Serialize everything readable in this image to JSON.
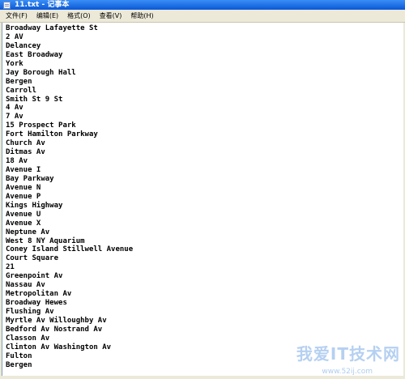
{
  "window": {
    "title": "11.txt - 记事本",
    "titlebar_color": "#0a58d6"
  },
  "menu": {
    "items": [
      "文件(F)",
      "编辑(E)",
      "格式(O)",
      "查看(V)",
      "帮助(H)"
    ]
  },
  "document": {
    "lines": [
      "Broadway Lafayette St",
      "2 AV",
      "Delancey",
      "East Broadway",
      "York",
      "Jay Borough Hall",
      "Bergen",
      "Carroll",
      "Smith St 9 St",
      "4 Av",
      "7 Av",
      "15 Prospect Park",
      "Fort Hamilton Parkway",
      "Church Av",
      "Ditmas Av",
      "18 Av",
      "Avenue I",
      "Bay Parkway",
      "Avenue N",
      "Avenue P",
      "Kings Highway",
      "Avenue U",
      "Avenue X",
      "Neptune Av",
      "West 8 NY Aquarium",
      "Coney Island Stillwell Avenue",
      "Court Square",
      "21",
      "Greenpoint Av",
      "Nassau Av",
      "Metropolitan Av",
      "Broadway Hewes",
      "Flushing Av",
      "Myrtle Av Willoughby Av",
      "Bedford Av Nostrand Av",
      "Classon Av",
      "Clinton Av Washington Av",
      "Fulton",
      "Bergen"
    ]
  },
  "watermark": {
    "text": "我爱IT技术网",
    "url": "www.52ij.com"
  }
}
